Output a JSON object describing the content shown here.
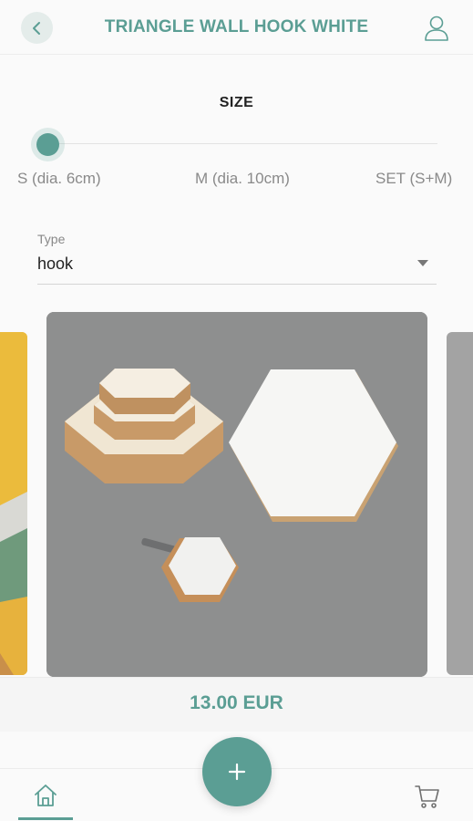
{
  "header": {
    "title": "TRIANGLE WALL HOOK WHITE",
    "back_icon": "chevron-left-icon",
    "user_icon": "user-icon"
  },
  "size": {
    "label": "SIZE",
    "options": [
      "S (dia. 6cm)",
      "M (dia. 10cm)",
      "SET (S+M)"
    ],
    "selected_index": 0
  },
  "type": {
    "caption": "Type",
    "value": "hook"
  },
  "product_image": {
    "description_icon": "product-photo"
  },
  "price": "13.00 EUR",
  "colors": {
    "accent": "#5b9e94",
    "background": "#fafafa"
  },
  "nav": {
    "home_icon": "home-icon",
    "add_icon": "plus-icon",
    "cart_icon": "cart-icon"
  }
}
